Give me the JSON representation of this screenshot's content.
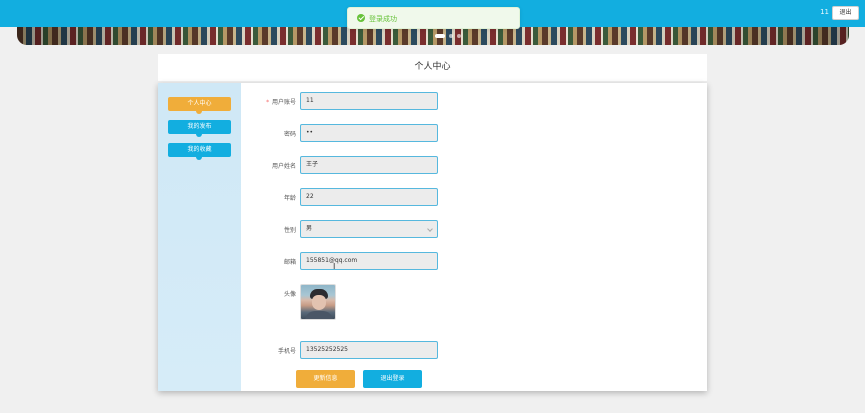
{
  "toast": {
    "icon": "check-circle-icon",
    "text": "登录成功"
  },
  "header": {
    "user_name": "11",
    "logout_label": "退出"
  },
  "page": {
    "title": "个人中心"
  },
  "sidebar": {
    "items": [
      {
        "label": "个人中心",
        "active": true
      },
      {
        "label": "我的发布",
        "active": false
      },
      {
        "label": "我的收藏",
        "active": false
      }
    ]
  },
  "form": {
    "username": {
      "label": "用户账号",
      "required": "*",
      "value": "11"
    },
    "password": {
      "label": "密码",
      "value": "••"
    },
    "realname": {
      "label": "用户姓名",
      "value": "王子"
    },
    "age": {
      "label": "年龄",
      "value": "22"
    },
    "gender": {
      "label": "性别",
      "value": "男"
    },
    "email": {
      "label": "邮箱",
      "value": "155851@qq.com"
    },
    "avatar": {
      "label": "头像"
    },
    "phone": {
      "label": "手机号",
      "value": "13525252525"
    }
  },
  "actions": {
    "update_label": "更新信息",
    "logout_label": "退出登录"
  },
  "colors": {
    "primary": "#12aee0",
    "accent": "#f0ad3a",
    "success": "#67c23a"
  }
}
